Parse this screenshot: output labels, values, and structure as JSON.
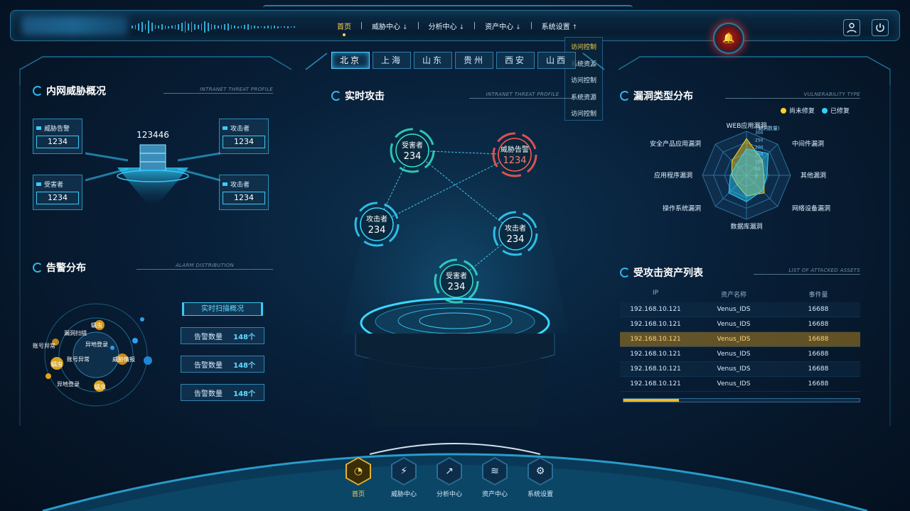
{
  "header": {
    "nav": [
      {
        "label": "首页",
        "active": true,
        "arrow": ""
      },
      {
        "label": "威胁中心",
        "active": false,
        "arrow": "↓"
      },
      {
        "label": "分析中心",
        "active": false,
        "arrow": "↓"
      },
      {
        "label": "资产中心",
        "active": false,
        "arrow": "↓"
      },
      {
        "label": "系统设置",
        "active": false,
        "arrow": "↑"
      }
    ],
    "dropdown": [
      "访问控制",
      "系统资源",
      "访问控制",
      "系统资源",
      "访问控制"
    ]
  },
  "cities": [
    "北京",
    "上海",
    "山东",
    "贵州",
    "西安",
    "山西"
  ],
  "intranet": {
    "title": "内网威胁概况",
    "subtitle": "INTRANET THREAT PROFILE",
    "total": "123446",
    "boxes": [
      {
        "label": "威胁告警",
        "value": "1234"
      },
      {
        "label": "攻击者",
        "value": "1234"
      },
      {
        "label": "受害者",
        "value": "1234"
      },
      {
        "label": "攻击者",
        "value": "1234"
      }
    ]
  },
  "alarm": {
    "title": "告警分布",
    "subtitle": "ALARM DISTRIBUTION",
    "scan_title": "实时扫描概况",
    "items": [
      {
        "label": "告警数量",
        "value": "148个"
      },
      {
        "label": "告警数量",
        "value": "148个"
      },
      {
        "label": "告警数量",
        "value": "148个"
      }
    ],
    "bubbles": [
      "蠕虫",
      "漏洞扫描",
      "异地登录",
      "账号异常",
      "蠕虫",
      "账号异常",
      "威胁情报",
      "异地登录",
      "蠕虫"
    ]
  },
  "realtime": {
    "title": "实时攻击",
    "subtitle": "INTRANET THREAT PROFILE",
    "nodes": [
      {
        "label": "受害者",
        "value": "234",
        "color": "#34e2c7"
      },
      {
        "label": "威胁告警",
        "value": "1234",
        "color": "#ff5a52"
      },
      {
        "label": "攻击者",
        "value": "234",
        "color": "#34d6ff"
      },
      {
        "label": "攻击者",
        "value": "234",
        "color": "#34d6ff"
      },
      {
        "label": "受害者",
        "value": "234",
        "color": "#34e2c7"
      }
    ]
  },
  "vuln": {
    "title": "漏洞类型分布",
    "subtitle": "VULNERABILITY TYPE",
    "legend": [
      {
        "label": "尚未修复",
        "color": "#ffd21e"
      },
      {
        "label": "已修复",
        "color": "#2ed3ff"
      }
    ],
    "axes": [
      "WEB应用漏洞",
      "中间件漏洞",
      "其他漏洞",
      "网络设备漏洞",
      "数据库漏洞",
      "操作系统漏洞",
      "应用程序漏洞",
      "安全产品应用漏洞"
    ],
    "unit_label": "(漏洞数量)",
    "ticks": [
      "300",
      "250",
      "200",
      "150",
      "100",
      "50",
      "0"
    ],
    "chart_data": {
      "type": "radar",
      "categories": [
        "WEB应用漏洞",
        "中间件漏洞",
        "其他漏洞",
        "网络设备漏洞",
        "数据库漏洞",
        "操作系统漏洞",
        "应用程序漏洞",
        "安全产品应用漏洞"
      ],
      "series": [
        {
          "name": "尚未修复",
          "values": [
            250,
            150,
            120,
            170,
            140,
            90,
            100,
            140
          ]
        },
        {
          "name": "已修复",
          "values": [
            180,
            210,
            140,
            150,
            180,
            170,
            110,
            100
          ]
        }
      ],
      "ylim": [
        0,
        300
      ]
    }
  },
  "assets": {
    "title": "受攻击资产列表",
    "subtitle": "LIST OF ATTACKED ASSETS",
    "headers": [
      "IP",
      "资产名称",
      "事件量"
    ],
    "rows": [
      [
        "192.168.10.121",
        "Venus_IDS",
        "16688"
      ],
      [
        "192.168.10.121",
        "Venus_IDS",
        "16688"
      ],
      [
        "192.168.10.121",
        "Venus_IDS",
        "16688"
      ],
      [
        "192.168.10.121",
        "Venus_IDS",
        "16688"
      ],
      [
        "192.168.10.121",
        "Venus_IDS",
        "16688"
      ],
      [
        "192.168.10.121",
        "Venus_IDS",
        "16688"
      ]
    ],
    "selected_row": 2
  },
  "bottom_nav": [
    {
      "label": "首页",
      "icon": "gauge-icon",
      "glyph": "◔",
      "active": true
    },
    {
      "label": "威胁中心",
      "icon": "shield-icon",
      "glyph": "⚡",
      "active": false
    },
    {
      "label": "分析中心",
      "icon": "chart-icon",
      "glyph": "↗",
      "active": false
    },
    {
      "label": "资产中心",
      "icon": "database-icon",
      "glyph": "≋",
      "active": false
    },
    {
      "label": "系统设置",
      "icon": "gear-icon",
      "glyph": "⚙",
      "active": false
    }
  ]
}
